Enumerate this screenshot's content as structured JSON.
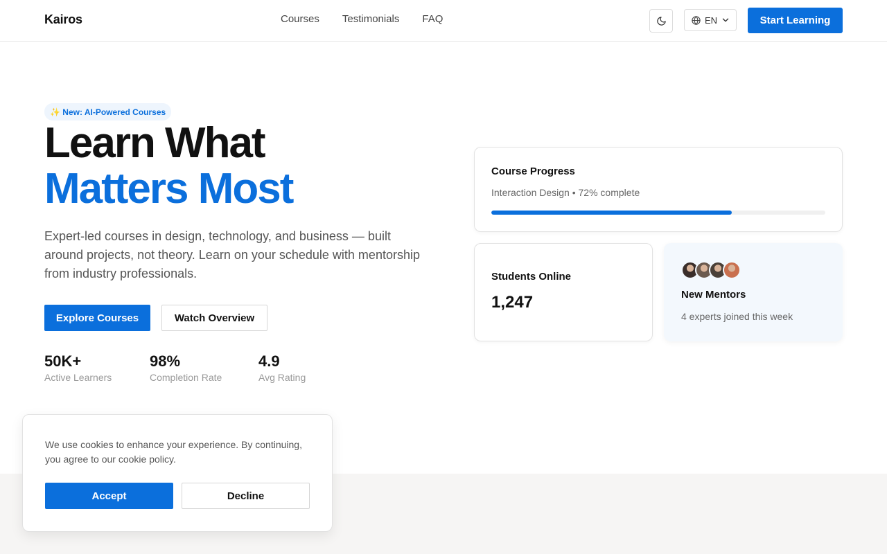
{
  "brand": {
    "name": "Kairos"
  },
  "nav": {
    "links": [
      "Courses",
      "Testimonials",
      "FAQ"
    ],
    "theme_icon": "moon-icon",
    "language": {
      "icon": "globe-icon",
      "selected": "EN"
    },
    "cta_label": "Start Learning"
  },
  "hero": {
    "badge": {
      "icon": "sparkles-icon",
      "text": "✨ New: AI-Powered Courses"
    },
    "title_line1": "Learn What",
    "title_line2": "Matters Most",
    "description": "Expert-led courses in design, technology, and business — built around projects, not theory. Learn on your schedule with mentorship from industry professionals.",
    "primary_button": "Explore Courses",
    "secondary_button": "Watch Overview",
    "stats": [
      {
        "value": "50K+",
        "label": "Active Learners"
      },
      {
        "value": "98%",
        "label": "Completion Rate"
      },
      {
        "value": "4.9",
        "label": "Avg Rating"
      }
    ]
  },
  "cards": {
    "progress": {
      "title": "Course Progress",
      "subtitle": "Interaction Design • 72% complete",
      "percent": 72
    },
    "students": {
      "title": "Students Online",
      "value": "1,247"
    },
    "mentors": {
      "title": "New Mentors",
      "subtitle": "4 experts joined this week",
      "avatar_count": 4
    }
  },
  "cookie": {
    "text": "We use cookies to enhance your experience. By continuing, you agree to our cookie policy.",
    "accept": "Accept",
    "decline": "Decline"
  },
  "colors": {
    "accent": "#0b6fdc",
    "avatar_tints": [
      "#3a2e2a",
      "#6b5a4e",
      "#4a4038",
      "#c9704f"
    ]
  }
}
